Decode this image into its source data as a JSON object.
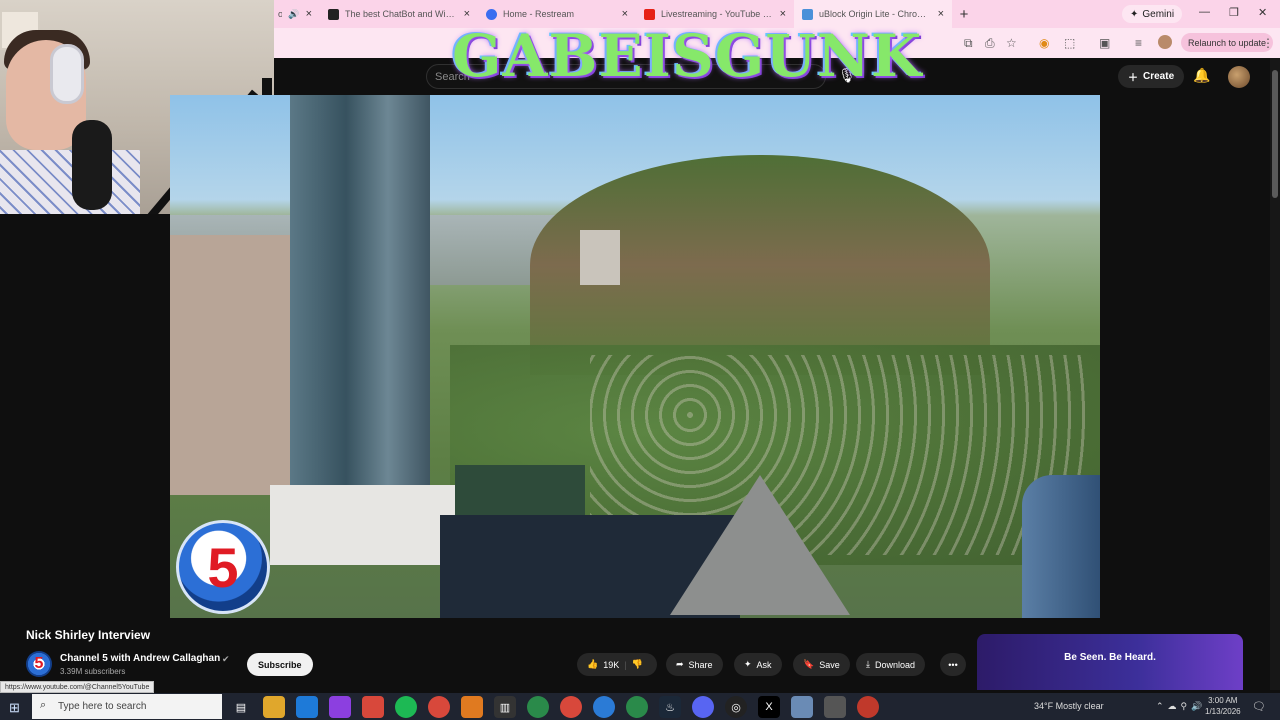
{
  "browser": {
    "tabs": [
      {
        "label": "ou",
        "active": false
      },
      {
        "label": "The best ChatBot and Widgets",
        "active": false
      },
      {
        "label": "Home - Restream",
        "active": false
      },
      {
        "label": "Livestreaming - YouTube Studio",
        "active": false
      },
      {
        "label": "uBlock Origin Lite - Chrome Web",
        "active": false
      }
    ],
    "new_tab": "+",
    "gemini_label": "Gemini",
    "relaunch_label": "Relaunch to update"
  },
  "overlay": {
    "brand_text": "GABEISGUNK"
  },
  "youtube": {
    "search_placeholder": "Search",
    "create_label": "Create",
    "video_title": "Nick Shirley Interview",
    "channel_name": "Channel 5 with Andrew Callaghan",
    "subscribers": "3.39M subscribers",
    "subscribe_label": "Subscribe",
    "channel_logo_text": "5",
    "actions": {
      "likes": "19K",
      "share": "Share",
      "ask": "Ask",
      "save": "Save",
      "download": "Download"
    },
    "ad_text": "Be Seen. Be Heard.",
    "status_url": "https://www.youtube.com/@Channel5YouTube"
  },
  "taskbar": {
    "search_placeholder": "Type here to search",
    "weather": "34°F  Mostly clear",
    "time": "3:00 AM",
    "date": "1/13/2026"
  }
}
